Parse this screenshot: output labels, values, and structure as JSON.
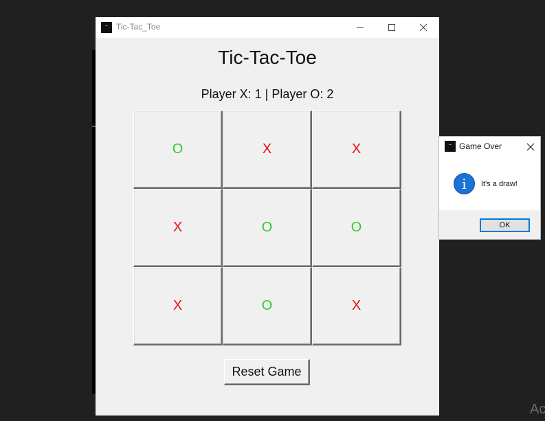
{
  "window": {
    "title": "Tic-Tac_Toe",
    "icon_text": "~"
  },
  "game": {
    "heading": "Tic-Tac-Toe",
    "score": "Player X: 1 | Player O: 2",
    "board": [
      [
        "O",
        "X",
        "X"
      ],
      [
        "X",
        "O",
        "O"
      ],
      [
        "X",
        "O",
        "X"
      ]
    ],
    "reset_label": "Reset Game"
  },
  "dialog": {
    "title": "Game Over",
    "icon_text": "~",
    "info_glyph": "i",
    "message": "It's a draw!",
    "ok_label": "OK"
  },
  "background": {
    "watermark": "Ac"
  },
  "colors": {
    "x_mark": "#e81010",
    "o_mark": "#2ecc2e",
    "accent": "#0078d7",
    "info": "#1a73d4"
  }
}
